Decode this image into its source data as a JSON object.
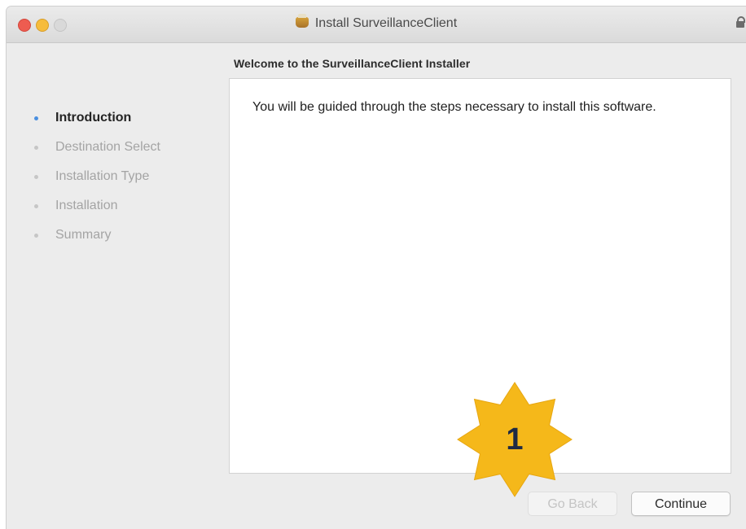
{
  "window": {
    "title": "Install SurveillanceClient"
  },
  "pane": {
    "heading": "Welcome to the SurveillanceClient Installer",
    "body": "You will be guided through the steps necessary to install this software."
  },
  "steps": [
    {
      "label": "Introduction",
      "active": true
    },
    {
      "label": "Destination Select",
      "active": false
    },
    {
      "label": "Installation Type",
      "active": false
    },
    {
      "label": "Installation",
      "active": false
    },
    {
      "label": "Summary",
      "active": false
    }
  ],
  "buttons": {
    "go_back": "Go Back",
    "continue": "Continue"
  },
  "annotation": {
    "number": "1",
    "color": "#f5b81a"
  },
  "icons": {
    "title_icon": "installer-package-icon",
    "lock_icon": "lock-icon"
  }
}
